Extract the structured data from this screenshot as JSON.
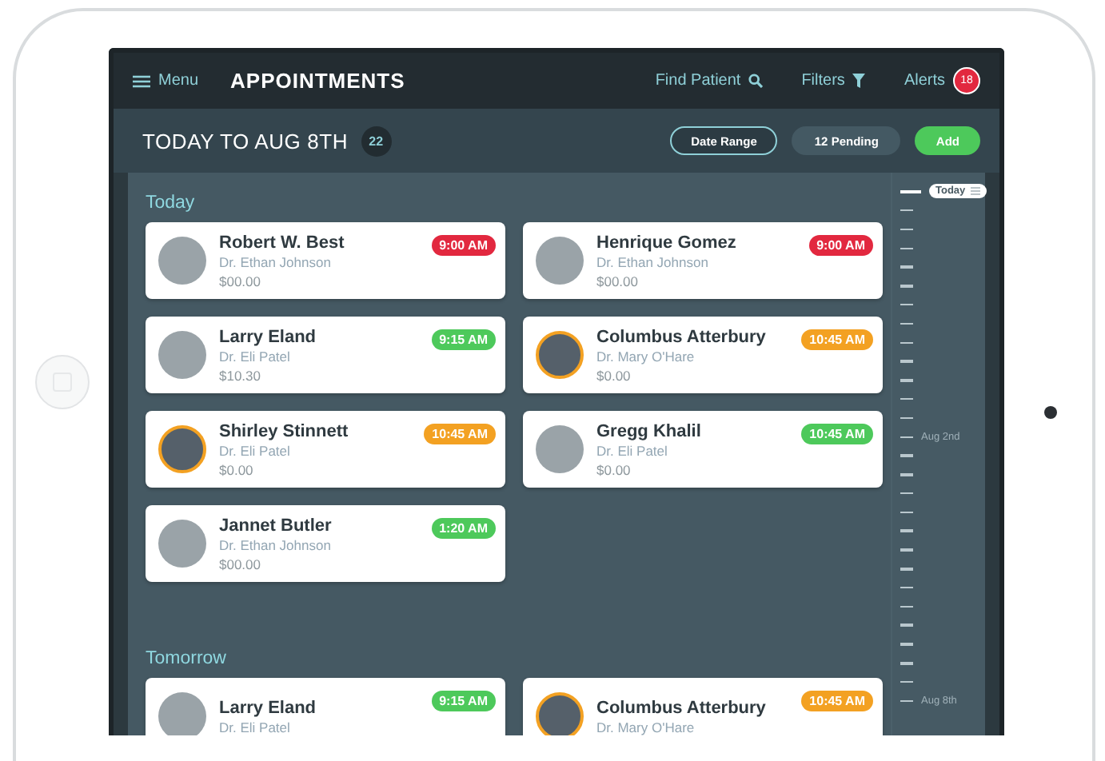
{
  "header": {
    "menu": "Menu",
    "title": "APPOINTMENTS",
    "find": "Find Patient",
    "filters": "Filters",
    "alerts": "Alerts",
    "alert_count": "18"
  },
  "toolbar": {
    "range_title": "TODAY TO AUG 8TH",
    "count": "22",
    "buttons": [
      {
        "label": "Date Range",
        "kind": "outline"
      },
      {
        "label": "12 Pending",
        "kind": "muted"
      },
      {
        "label": "Add",
        "kind": "primary"
      }
    ]
  },
  "sections": [
    {
      "title": "Today",
      "appointments": [
        {
          "name": "Robert W. Best",
          "doctor": "Dr. Ethan Johnson",
          "amount": "$00.00",
          "time": "9:00 AM",
          "color": "#e2283f",
          "ringed": false
        },
        {
          "name": "Henrique Gomez",
          "doctor": "Dr. Ethan Johnson",
          "amount": "$00.00",
          "time": "9:00 AM",
          "color": "#e2283f",
          "ringed": false
        },
        {
          "name": "Larry Eland",
          "doctor": "Dr. Eli Patel",
          "amount": "$10.30",
          "time": "9:15 AM",
          "color": "#4dc95b",
          "ringed": false
        },
        {
          "name": "Columbus Atterbury",
          "doctor": "Dr. Mary O'Hare",
          "amount": "$0.00",
          "time": "10:45 AM",
          "color": "#f3a122",
          "ringed": true
        },
        {
          "name": "Shirley Stinnett",
          "doctor": "Dr. Eli Patel",
          "amount": "$0.00",
          "time": "10:45 AM",
          "color": "#f3a122",
          "ringed": true
        },
        {
          "name": "Gregg Khalil",
          "doctor": "Dr. Eli Patel",
          "amount": "$0.00",
          "time": "10:45 AM",
          "color": "#4dc95b",
          "ringed": false
        },
        {
          "name": "Jannet Butler",
          "doctor": "Dr. Ethan Johnson",
          "amount": "$00.00",
          "time": "1:20 AM",
          "color": "#4dc95b",
          "ringed": false
        }
      ]
    },
    {
      "title": "Tomorrow",
      "appointments": [
        {
          "name": "Larry Eland",
          "doctor": "Dr. Eli Patel",
          "time": "9:15 AM",
          "color": "#4dc95b",
          "ringed": false
        },
        {
          "name": "Columbus Atterbury",
          "doctor": "Dr. Mary O'Hare",
          "time": "10:45 AM",
          "color": "#f3a122",
          "ringed": true
        }
      ]
    }
  ],
  "timeline": {
    "labels": [
      {
        "text": "Today",
        "kind": "pill"
      },
      {
        "text": "Aug 2nd",
        "kind": "plain"
      },
      {
        "text": "Aug 8th",
        "kind": "plain"
      }
    ]
  }
}
